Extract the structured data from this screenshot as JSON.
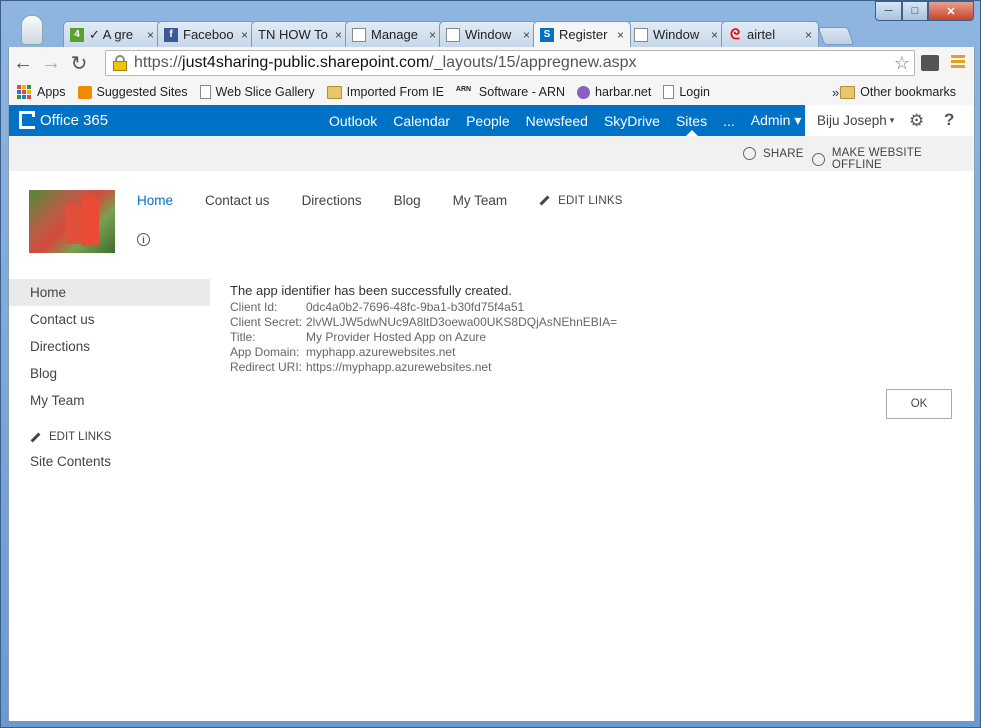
{
  "browser": {
    "window_buttons": {
      "minimize": "─",
      "maximize": "□",
      "close": "✕"
    },
    "tabs": [
      {
        "label": "A gre",
        "icon_text": "4",
        "icon_color": "#5aa02c",
        "icon_name": "checklist-icon"
      },
      {
        "label": "Faceboo",
        "icon_text": "f",
        "icon_color": "#3b5998",
        "icon_name": "facebook-icon"
      },
      {
        "label": "TN HOW To",
        "icon_text": "",
        "icon_color": "",
        "icon_name": ""
      },
      {
        "label": "Manage",
        "icon_text": "",
        "icon_color": "",
        "icon_name": "page-icon"
      },
      {
        "label": "Window",
        "icon_text": "",
        "icon_color": "",
        "icon_name": "page-icon"
      },
      {
        "label": "Register",
        "icon_text": "S",
        "icon_color": "#0072c6",
        "icon_name": "sharepoint-icon",
        "active": true
      },
      {
        "label": "Window",
        "icon_text": "",
        "icon_color": "",
        "icon_name": "page-icon"
      },
      {
        "label": "airtel",
        "icon_text": "",
        "icon_color": "#e40000",
        "icon_name": "airtel-icon"
      }
    ],
    "tab_close": "×",
    "url": {
      "scheme": "https://",
      "host": "just4sharing-public.sharepoint.com",
      "path": "/_layouts/15/appregnew.aspx"
    },
    "bookmarks": [
      {
        "label": "Apps",
        "icon": "apps-grid-icon"
      },
      {
        "label": "Suggested Sites",
        "icon": "suggested-sites-icon"
      },
      {
        "label": "Web Slice Gallery",
        "icon": "page-icon"
      },
      {
        "label": "Imported From IE",
        "icon": "folder-icon"
      },
      {
        "label": "Software - ARN",
        "icon": "arn-icon"
      },
      {
        "label": "harbar.net",
        "icon": "harbar-icon"
      },
      {
        "label": "Login",
        "icon": "page-icon"
      }
    ],
    "bookmarks_overflow": "»",
    "other_bookmarks": "Other bookmarks"
  },
  "suitebar": {
    "brand": "Office 365",
    "links": [
      "Outlook",
      "Calendar",
      "People",
      "Newsfeed",
      "SkyDrive",
      "Sites",
      "...",
      "Admin ▾"
    ],
    "active_link": "Sites",
    "user": "Biju Joseph",
    "user_caret": "▾",
    "settings_glyph": "⚙",
    "help_glyph": "?"
  },
  "ribbon": {
    "share": "SHARE",
    "offline": "MAKE WEBSITE OFFLINE"
  },
  "topnav": {
    "items": [
      "Home",
      "Contact us",
      "Directions",
      "Blog",
      "My Team"
    ],
    "edit_links": "EDIT LINKS",
    "info_glyph": "i"
  },
  "leftnav": {
    "items": [
      "Home",
      "Contact us",
      "Directions",
      "Blog",
      "My Team"
    ],
    "edit_links": "EDIT LINKS",
    "site_contents": "Site Contents"
  },
  "main": {
    "message": "The app identifier has been successfully created.",
    "fields": [
      {
        "key": "Client Id:",
        "value": "0dc4a0b2-7696-48fc-9ba1-b30fd75f4a51"
      },
      {
        "key": "Client Secret:",
        "value": "2lvWLJW5dwNUc9A8ltD3oewa00UKS8DQjAsNEhnEBIA="
      },
      {
        "key": "Title:",
        "value": "My Provider Hosted App on Azure"
      },
      {
        "key": "App Domain:",
        "value": "myphapp.azurewebsites.net"
      },
      {
        "key": "Redirect URI:",
        "value": "https://myphapp.azurewebsites.net"
      }
    ],
    "ok_label": "OK"
  },
  "colors": {
    "suitebar": "#0072c6",
    "accent_link": "#0072c6"
  }
}
